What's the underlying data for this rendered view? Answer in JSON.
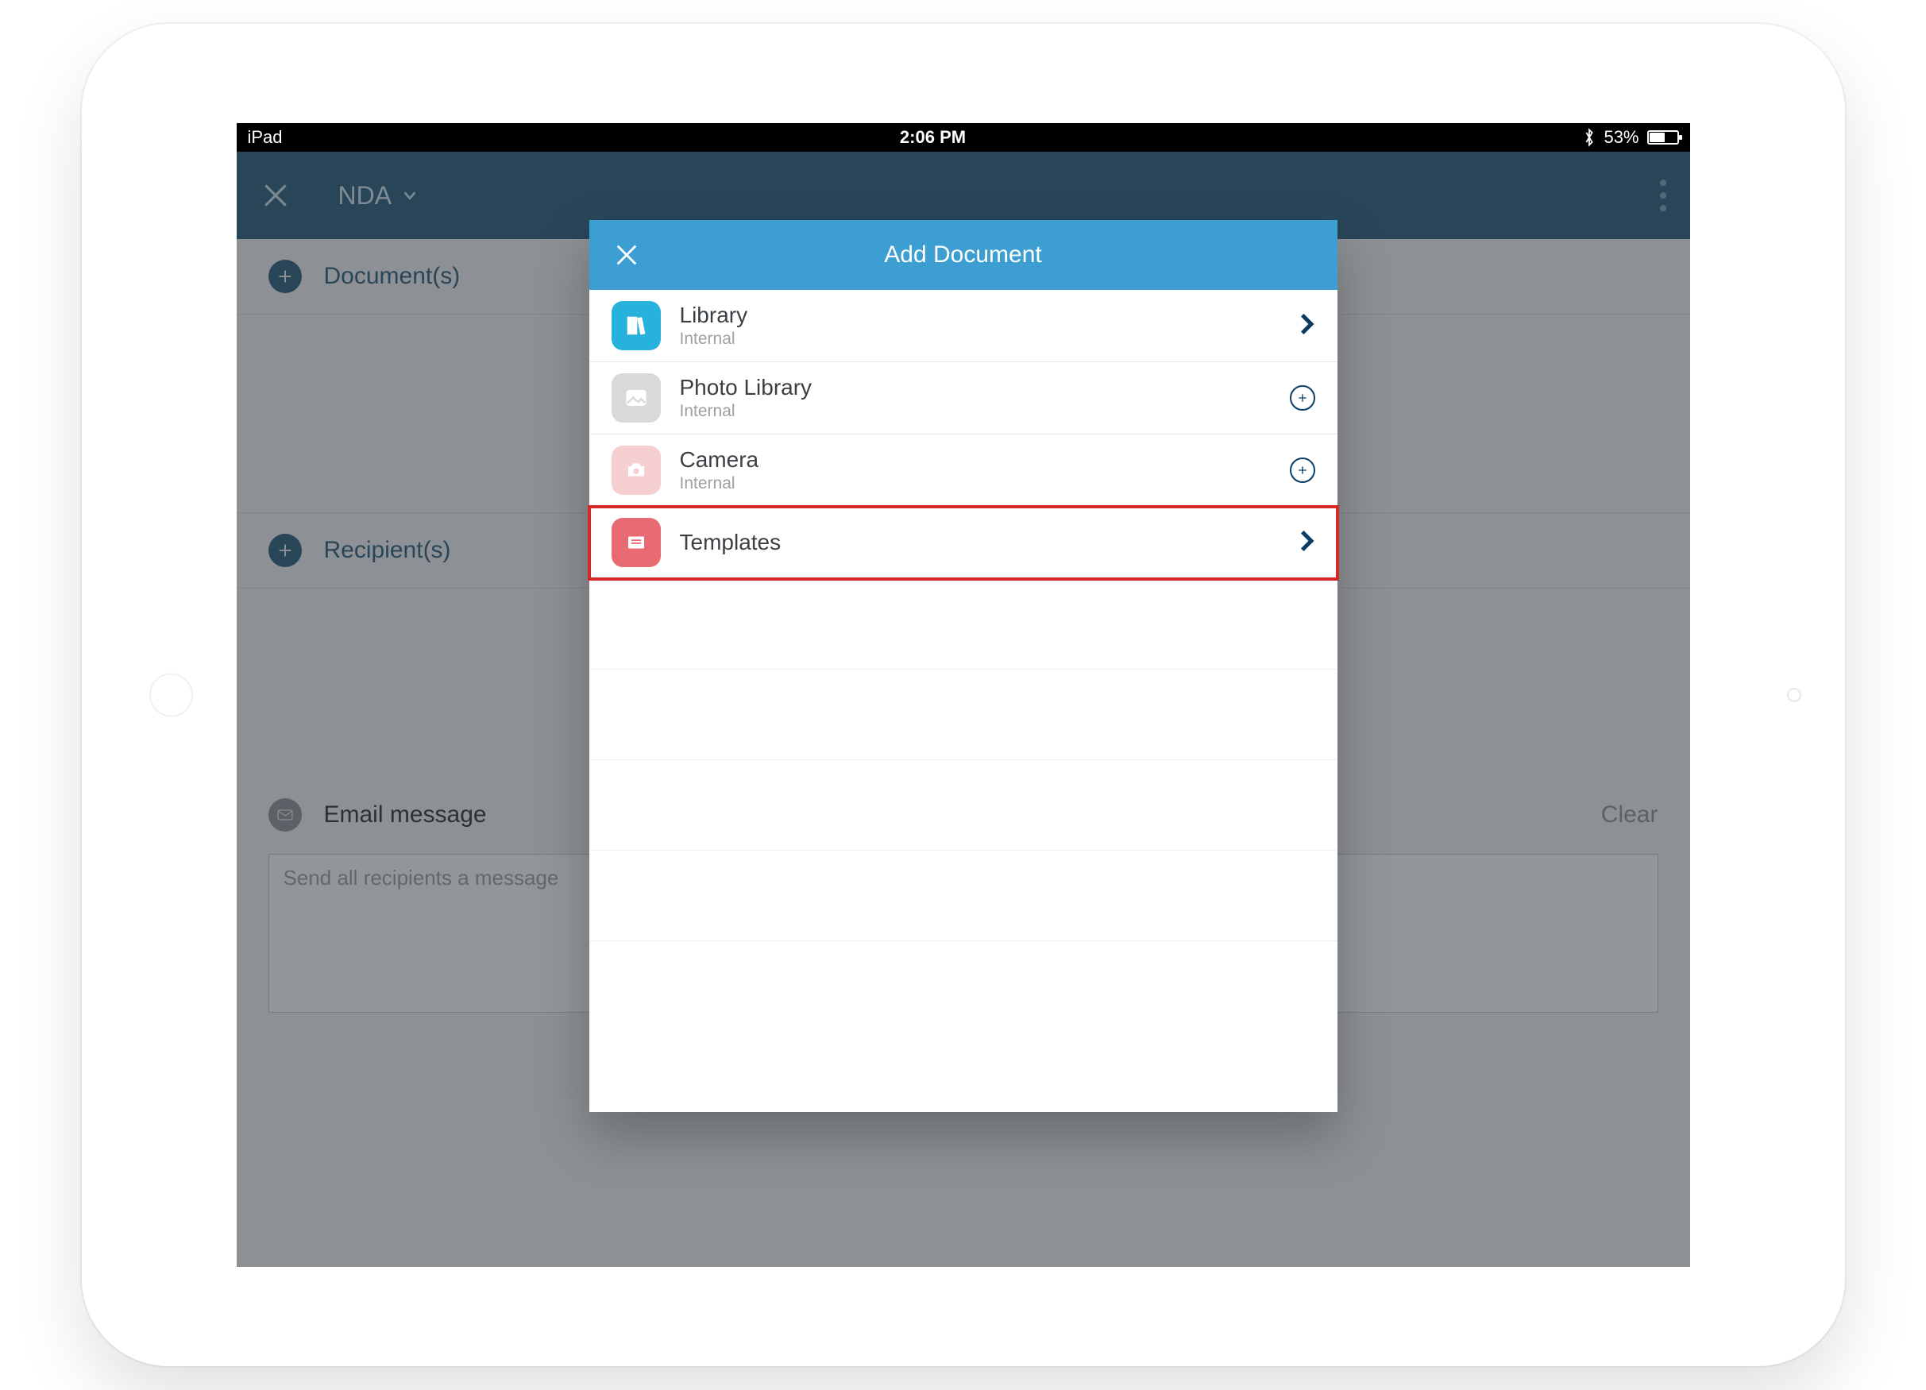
{
  "status": {
    "device": "iPad",
    "time": "2:06 PM",
    "battery_pct": "53%",
    "battery_fill": 53
  },
  "header": {
    "title": "NDA"
  },
  "sections": {
    "documents": "Document(s)",
    "recipients": "Recipient(s)",
    "email_label": "Email message",
    "clear": "Clear",
    "placeholder": "Send all recipients a message"
  },
  "modal": {
    "title": "Add Document",
    "options": [
      {
        "title": "Library",
        "sub": "Internal",
        "icon": "library-icon",
        "color": "blue",
        "action": "chevron"
      },
      {
        "title": "Photo Library",
        "sub": "Internal",
        "icon": "photo-icon",
        "color": "grey",
        "action": "add"
      },
      {
        "title": "Camera",
        "sub": "Internal",
        "icon": "camera-icon",
        "color": "pink",
        "action": "add"
      },
      {
        "title": "Templates",
        "sub": "",
        "icon": "template-icon",
        "color": "red",
        "action": "chevron",
        "highlight": true
      }
    ]
  }
}
